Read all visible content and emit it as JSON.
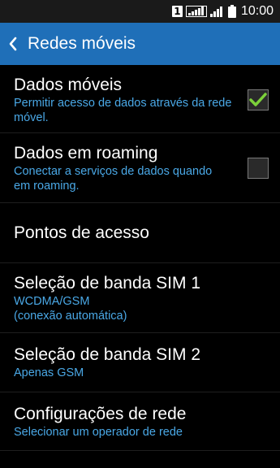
{
  "status_bar": {
    "sim_badge": "1",
    "time": "10:00",
    "icons": [
      "sim1-badge-icon",
      "signal-sim1-icon",
      "signal-sim2-icon",
      "battery-icon"
    ]
  },
  "header": {
    "back_icon": "chevron-left-icon",
    "title": "Redes móveis",
    "background_color": "#1f6fb8"
  },
  "items": [
    {
      "title": "Dados móveis",
      "subtitle": "Permitir acesso de dados através da rede móvel.",
      "checkbox": true,
      "checked": true
    },
    {
      "title": "Dados em roaming",
      "subtitle": "Conectar a serviços de dados quando em roaming.",
      "checkbox": true,
      "checked": false
    },
    {
      "title": "Pontos de acesso",
      "subtitle": ""
    },
    {
      "title": "Seleção de banda SIM 1",
      "subtitle": "WCDMA/GSM\n(conexão automática)"
    },
    {
      "title": "Seleção de banda SIM 2",
      "subtitle": "Apenas GSM"
    },
    {
      "title": "Configurações de rede",
      "subtitle": "Selecionar um operador de rede"
    }
  ],
  "colors": {
    "accent_text": "#4aa8e6",
    "check_color": "#7cd13a"
  }
}
